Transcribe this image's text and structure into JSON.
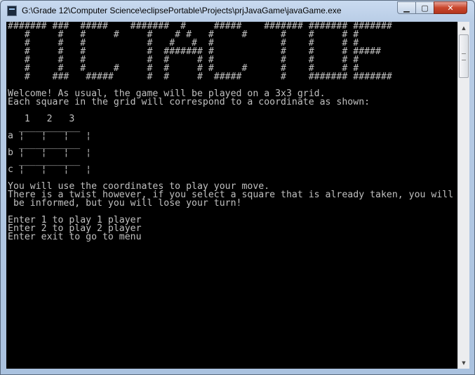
{
  "window": {
    "title": "G:\\Grade 12\\Computer Science\\eclipsePortable\\Projects\\prjJavaGame\\javaGame.exe",
    "controls": {
      "minimize": "▁",
      "maximize": "▢",
      "close": "✕"
    }
  },
  "console": {
    "lines": [
      "####### ###  #####    #######  #     #####    ####### ####### #######",
      "   #     #   #     #     #    # #   #     #      #    #     # #",
      "   #     #   #           #   #   #  #            #    #     # #",
      "   #     #   #           #  ####### #            #    #     # #####",
      "   #     #   #           #  #     # #            #    #     # #",
      "   #     #   #     #     #  #     # #     #      #    #     # #",
      "   #    ###   #####      #  #     #  #####       #    ####### #######",
      "",
      "Welcome! As usual, the game will be played on a 3x3 grid.",
      "Each square in the grid will correspond to a coordinate as shown:",
      "",
      "   1   2   3",
      "  ___________",
      "a ¦   ¦   ¦   ¦",
      "  ___________",
      "b ¦   ¦   ¦   ¦",
      "  ___________",
      "c ¦   ¦   ¦   ¦",
      "",
      "You will use the coordinates to play your move.",
      "There is a twist however, if you select a square that is already taken, you will",
      " be informed, but you will lose your turn!",
      "",
      "Enter 1 to play 1 player",
      "Enter 2 to play 2 player",
      "Enter exit to go to menu"
    ]
  },
  "scrollbar": {
    "up": "▲",
    "down": "▼"
  }
}
